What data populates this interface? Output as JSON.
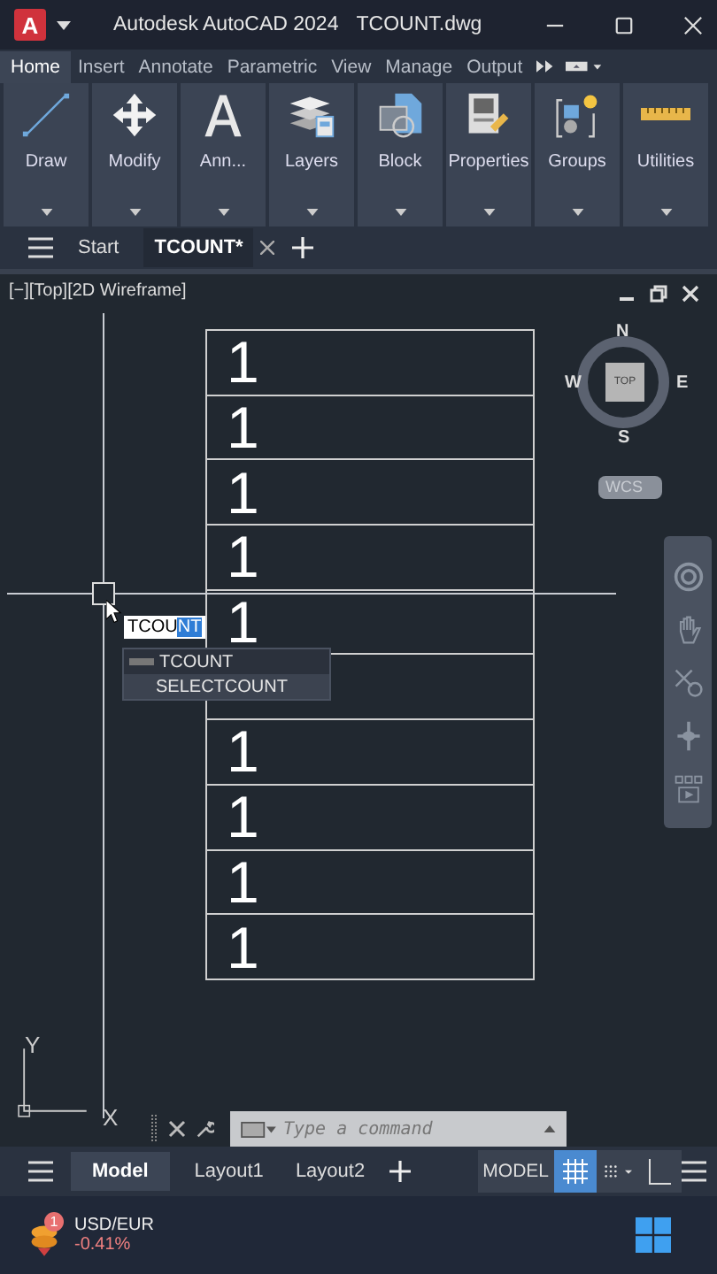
{
  "title_bar": {
    "app_letter": "A",
    "title": "Autodesk AutoCAD 2024",
    "document": "TCOUNT.dwg"
  },
  "ribbon_tabs": [
    {
      "label": "Home",
      "selected": true
    },
    {
      "label": "Insert",
      "selected": false
    },
    {
      "label": "Annotate",
      "selected": false
    },
    {
      "label": "Parametric",
      "selected": false
    },
    {
      "label": "View",
      "selected": false
    },
    {
      "label": "Manage",
      "selected": false
    },
    {
      "label": "Output",
      "selected": false
    }
  ],
  "ribbon_panels": [
    {
      "label": "Draw",
      "kind": "line"
    },
    {
      "label": "Modify",
      "kind": "move"
    },
    {
      "label": "Ann...",
      "kind": "text"
    },
    {
      "label": "Layers",
      "kind": "layers"
    },
    {
      "label": "Block",
      "kind": "block"
    },
    {
      "label": "Properties",
      "kind": "properties"
    },
    {
      "label": "Groups",
      "kind": "groups"
    },
    {
      "label": "Utilities",
      "kind": "measure"
    }
  ],
  "file_tabs": [
    {
      "label": "Start",
      "selected": false
    },
    {
      "label": "TCOUNT*",
      "selected": true
    }
  ],
  "viewport": {
    "label": "[−][Top][2D Wireframe]"
  },
  "viewcube": {
    "top": "TOP",
    "north": "N",
    "east": "E",
    "south": "S",
    "west": "W",
    "ucs": "WCS"
  },
  "table": {
    "rows": [
      {
        "kind": "value",
        "text": "1"
      },
      {
        "kind": "value",
        "text": "1"
      },
      {
        "kind": "value",
        "text": "1"
      },
      {
        "kind": "value",
        "text": "1"
      },
      {
        "kind": "value",
        "text": "1"
      },
      {
        "kind": "covered"
      },
      {
        "kind": "value",
        "text": "1"
      },
      {
        "kind": "value",
        "text": "1"
      },
      {
        "kind": "value",
        "text": "1"
      },
      {
        "kind": "value",
        "text": "1"
      }
    ]
  },
  "autocomplete": {
    "typed": "TCOU",
    "completion": "NT",
    "suggestions": [
      {
        "label": "TCOUNT",
        "selected": false
      },
      {
        "label": "SELECTCOUNT",
        "selected": true
      }
    ]
  },
  "ucs_icon": {
    "x": "X",
    "y": "Y"
  },
  "command_line": {
    "placeholder": "Type a command"
  },
  "layout_tabs": [
    {
      "label": "Model",
      "selected": true
    },
    {
      "label": "Layout1",
      "selected": false
    },
    {
      "label": "Layout2",
      "selected": false
    }
  ],
  "status_bar": {
    "space": "MODEL",
    "grid_on": true
  },
  "taskbar": {
    "widget_title": "USD/EUR",
    "widget_value": "-0.41%",
    "badge": "1"
  }
}
